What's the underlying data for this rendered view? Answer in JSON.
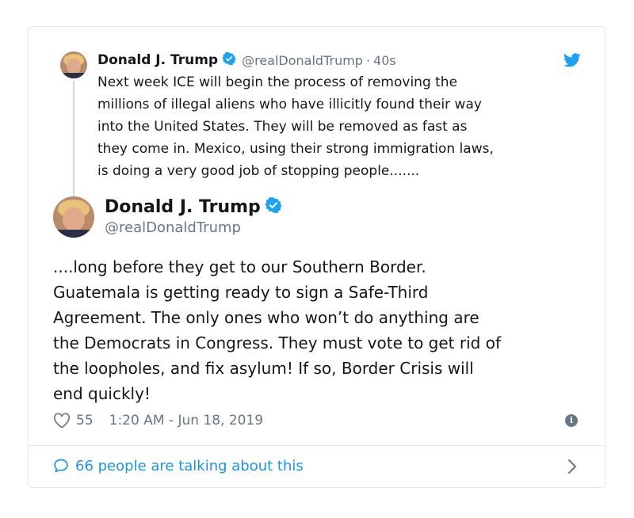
{
  "quoted_tweet": {
    "author_name": "Donald J. Trump",
    "handle": "@realDonaldTrump",
    "separator": "·",
    "time_ago": "40s",
    "text": "Next week ICE will begin the process of removing the\nmillions of illegal aliens who have illicitly found their way\ninto the United States. They will be removed as fast as\nthey come in. Mexico, using their strong immigration laws,\nis doing a very good job of stopping people......."
  },
  "main_tweet": {
    "author_name": "Donald J. Trump",
    "handle": "@realDonaldTrump",
    "text": "....long before they get to our Southern Border.\nGuatemala is getting ready to sign a Safe-Third\nAgreement. The only ones who won’t do anything are\nthe Democrats in Congress. They must vote to get rid of\nthe loopholes, and fix asylum! If so, Border Crisis will\nend quickly!",
    "likes": "55",
    "timestamp": "1:20 AM - Jun 18, 2019"
  },
  "footer": {
    "talking_text": "66 people are talking about this"
  },
  "icons": {
    "verified": "verified-badge-icon",
    "bird": "twitter-bird-icon",
    "heart": "heart-icon",
    "info": "info-icon",
    "comment": "comment-bubble-icon",
    "chevron": "chevron-right-icon"
  },
  "colors": {
    "accent_blue": "#1da1f2",
    "link_blue": "#1b95e0",
    "muted_gray": "#657786",
    "text_dark": "#14171a",
    "border": "#e1e8ed"
  }
}
